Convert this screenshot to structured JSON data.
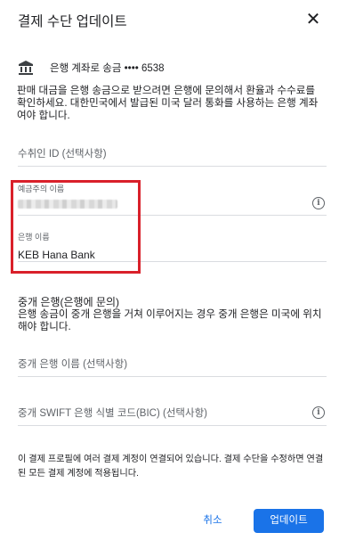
{
  "dialog": {
    "title": "결제 수단 업데이트",
    "close_icon": "close-icon"
  },
  "payment_method": {
    "icon": "bank-icon",
    "label": "은행 계좌로 송금 •••• 6538"
  },
  "description": "판매 대금을 은행 송금으로 받으려면 은행에 문의해서 환율과 수수료를 확인하세요. 대한민국에서 발급된 미국 달러 통화를 사용하는 은행 계좌여야 합니다.",
  "fields": {
    "recipient_id": {
      "placeholder": "수취인 ID (선택사항)"
    },
    "account_holder": {
      "label": "예금주의 이름",
      "value_redacted": true,
      "info_icon": "info-icon"
    },
    "bank_name": {
      "label": "은행 이름",
      "value": "KEB Hana Bank"
    },
    "intermediary_bank_name": {
      "placeholder": "중개 은행 이름 (선택사항)"
    },
    "intermediary_swift": {
      "placeholder": "중개 SWIFT 은행 식별 코드(BIC) (선택사항)",
      "info_icon": "info-icon"
    }
  },
  "intermediary": {
    "title": "중개 은행(은행에 문의)",
    "description": "은행 송금이 중개 은행을 거쳐 이루어지는 경우 중개 은행은 미국에 위치해야 합니다."
  },
  "footnote": "이 결제 프로필에 여러 결제 계정이 연결되어 있습니다. 결제 수단을 수정하면 연결된 모든 결제 계정에 적용됩니다.",
  "actions": {
    "cancel": "취소",
    "update": "업데이트"
  },
  "colors": {
    "accent": "#1a73e8",
    "highlight": "#d9202a",
    "divider": "#dadce0"
  }
}
